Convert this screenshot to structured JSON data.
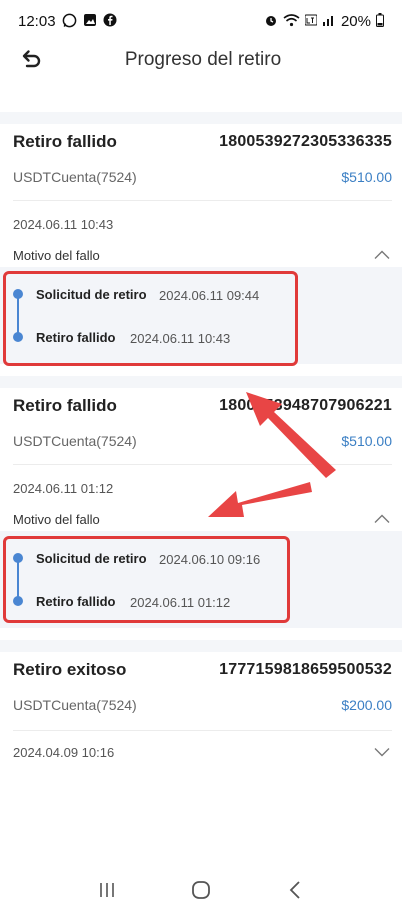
{
  "status_bar": {
    "time": "12:03",
    "battery": "20%",
    "left_icons": [
      "whatsapp-icon",
      "gallery-icon",
      "facebook-icon"
    ],
    "right_icons": [
      "alarm-icon",
      "wifi-icon",
      "lte-icon",
      "signal-icon",
      "battery-icon"
    ]
  },
  "header": {
    "title": "Progreso del retiro"
  },
  "records": [
    {
      "status": "Retiro fallido",
      "order_id": "1800539272305336335",
      "account": "USDTCuenta(7524)",
      "amount": "$510.00",
      "date": "2024.06.11 10:43",
      "reason_label": "Motivo del fallo",
      "expanded": true,
      "timeline": [
        {
          "label": "Solicitud de retiro",
          "time": "2024.06.11 09:44"
        },
        {
          "label": "Retiro fallido",
          "time": "2024.06.11 10:43"
        }
      ]
    },
    {
      "status": "Retiro fallido",
      "order_id": "1800553948707906221",
      "account": "USDTCuenta(7524)",
      "amount": "$510.00",
      "date": "2024.06.11 01:12",
      "reason_label": "Motivo del fallo",
      "expanded": true,
      "timeline": [
        {
          "label": "Solicitud de retiro",
          "time": "2024.06.10 09:16"
        },
        {
          "label": "Retiro fallido",
          "time": "2024.06.11 01:12"
        }
      ]
    },
    {
      "status": "Retiro exitoso",
      "order_id": "1777159818659500532",
      "account": "USDTCuenta(7524)",
      "amount": "$200.00",
      "date": "2024.04.09 10:16",
      "expanded": false
    }
  ],
  "annotation_color": "#e03a3a",
  "accent_color": "#3b7fc4"
}
